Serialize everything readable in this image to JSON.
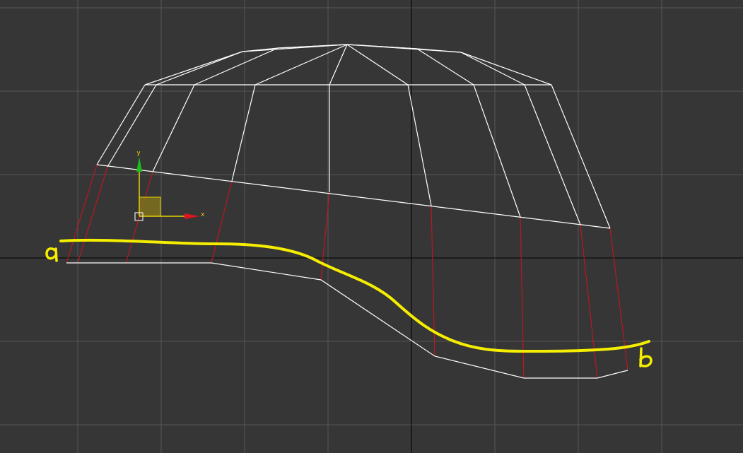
{
  "viewport": {
    "gizmo": {
      "x_axis_label": "x",
      "y_axis_label": "y",
      "x_color": "#e0141e",
      "y_color": "#1bbf1b",
      "plane_color": "#e8d000"
    },
    "annotations": {
      "start_label": "a",
      "end_label": "b",
      "curve_color": "#f5ee00"
    },
    "colors": {
      "background": "#363636",
      "grid": "#555555",
      "grid_axis": "#0c0c0c",
      "wireframe": "#ffffff",
      "edges_selected": "#c8141e"
    }
  }
}
